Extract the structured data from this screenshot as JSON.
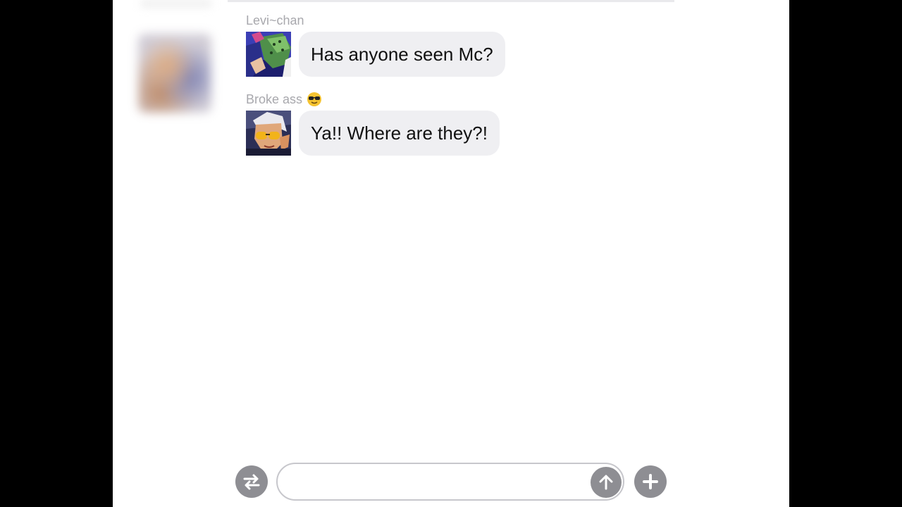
{
  "chat": {
    "messages": [
      {
        "sender": "Levi~chan",
        "sender_emoji": "",
        "avatar": "levi-avatar",
        "text": "Has anyone seen Mc?"
      },
      {
        "sender": "Broke ass",
        "sender_emoji": "sunglasses-emoji",
        "avatar": "broke-ass-avatar",
        "text": "Ya!! Where are they?!"
      }
    ]
  },
  "composer": {
    "placeholder": "",
    "value": "",
    "swap_icon": "swap-arrows-icon",
    "send_icon": "arrow-up-icon",
    "add_icon": "plus-icon"
  },
  "colors": {
    "bubble": "#efeff2",
    "button": "#8e8e93",
    "sender_text": "#a8a8ad"
  }
}
